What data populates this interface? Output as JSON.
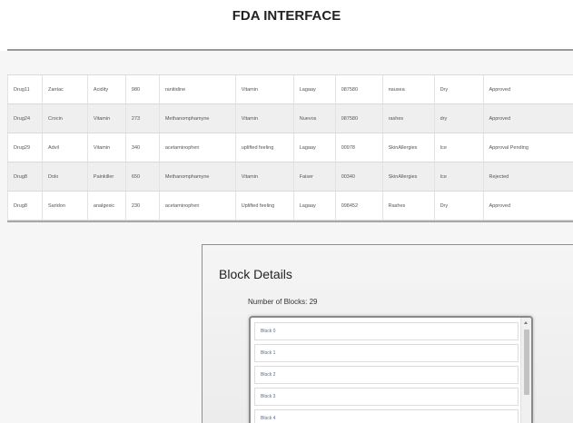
{
  "header": {
    "title": "FDA INTERFACE"
  },
  "drugs": {
    "rows": [
      [
        "Drug11",
        "Zantac",
        "Acidity",
        "980",
        "ranitidine",
        "Vitamin",
        "Lagaay",
        "087580",
        "nausea",
        "Dry",
        "Approved"
      ],
      [
        "Drug24",
        "Crocin",
        "Vitamin",
        "273",
        "Methanomphamyne",
        "Vitamin",
        "Nuevos",
        "087580",
        "rashes",
        "dry",
        "Approved"
      ],
      [
        "Drug29",
        "Advil",
        "Vitamin",
        "340",
        "acetaminophen",
        "uplifted feeling",
        "Lagaay",
        "00978",
        "SkinAllergies",
        "Ice",
        "Approval Pending"
      ],
      [
        "Drug8",
        "Dolo",
        "Painkiller",
        "650",
        "Methanomphamyne",
        "Vitamin",
        "Faiser",
        "00340",
        "SkinAllergies",
        "Ice",
        "Rejected"
      ],
      [
        "Drug8",
        "Saridon",
        "analgesic",
        "230",
        "acetaminophen",
        "Uplifted feeling",
        "Lagaay",
        "098452",
        "Rashes",
        "Dry",
        "Approved"
      ]
    ]
  },
  "blocks": {
    "title": "Block Details",
    "count_text": "Number of Blocks: 29",
    "items": [
      "Block 0",
      "Block 1",
      "Block 2",
      "Block 3",
      "Block 4"
    ]
  }
}
